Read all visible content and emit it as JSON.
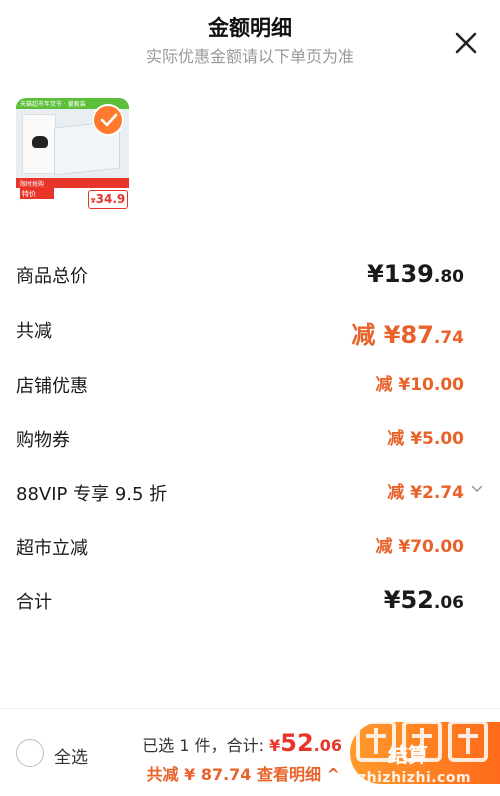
{
  "header": {
    "title": "金额明细",
    "subtitle": "实际优惠金额请以下单页为准"
  },
  "product": {
    "thumb_top_text": "天猫超市年货节 · 量贩装",
    "thumb_band_text": "限时抢购",
    "thumb_badge_text": "特价",
    "price_yen": "¥",
    "price": "34.9"
  },
  "rows": {
    "total": {
      "label": "商品总价",
      "yen": "¥",
      "int": "139",
      "dec": ".80"
    },
    "reduce": {
      "label": "共减",
      "prefix": "减 ¥",
      "int": "87",
      "dec": ".74"
    },
    "shop": {
      "label": "店铺优惠",
      "prefix": "减 ¥",
      "int": "10",
      "dec": ".00"
    },
    "coupon": {
      "label": "购物券",
      "prefix": "减 ¥",
      "int": "5",
      "dec": ".00"
    },
    "vip": {
      "label": "88VIP 专享 9.5 折",
      "prefix": "减 ¥",
      "int": "2",
      "dec": ".74"
    },
    "market": {
      "label": "超市立减",
      "prefix": "减 ¥",
      "int": "70",
      "dec": ".00"
    },
    "sum": {
      "label": "合计",
      "yen": "¥",
      "int": "52",
      "dec": ".06"
    }
  },
  "bottom": {
    "select_all": "全选",
    "selected_text": "已选 1 件，合计:",
    "yen": "¥",
    "amount_int": "52",
    "amount_dec": ".06",
    "reduce_text": "共减 ¥ 87.74",
    "detail_text": "查看明细 ^",
    "checkout": "结算",
    "watermark_site": "zhizhizhi.com"
  },
  "colors": {
    "accent": "#e8622a",
    "red": "#e8352a",
    "checkout_start": "#ff9a2c",
    "checkout_end": "#ff6a1a"
  }
}
